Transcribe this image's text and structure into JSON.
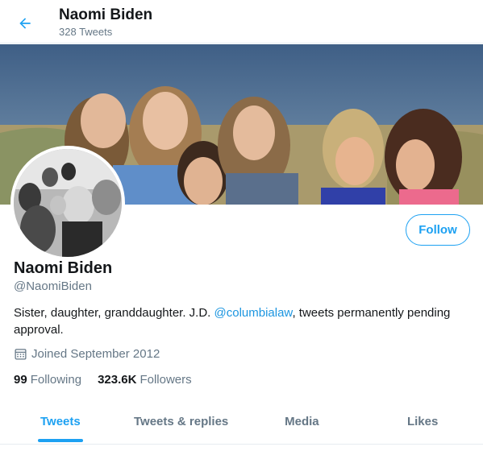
{
  "header": {
    "title": "Naomi Biden",
    "tweet_count": "328 Tweets",
    "back_icon": "arrow-left-icon"
  },
  "profile": {
    "name": "Naomi Biden",
    "handle": "@NaomiBiden",
    "bio_before": "Sister, daughter, granddaughter. J.D. ",
    "bio_mention": "@columbialaw",
    "bio_after": ", tweets permanently pending approval.",
    "joined": "Joined September 2012",
    "following_count": "99",
    "following_label": "Following",
    "followers_count": "323.6K",
    "followers_label": "Followers",
    "follow_label": "Follow"
  },
  "tabs": [
    {
      "label": "Tweets",
      "active": true
    },
    {
      "label": "Tweets & replies",
      "active": false
    },
    {
      "label": "Media",
      "active": false
    },
    {
      "label": "Likes",
      "active": false
    }
  ],
  "colors": {
    "accent": "#1da1f2",
    "link": "#1b95e0",
    "muted": "#657786",
    "text": "#14171a"
  }
}
